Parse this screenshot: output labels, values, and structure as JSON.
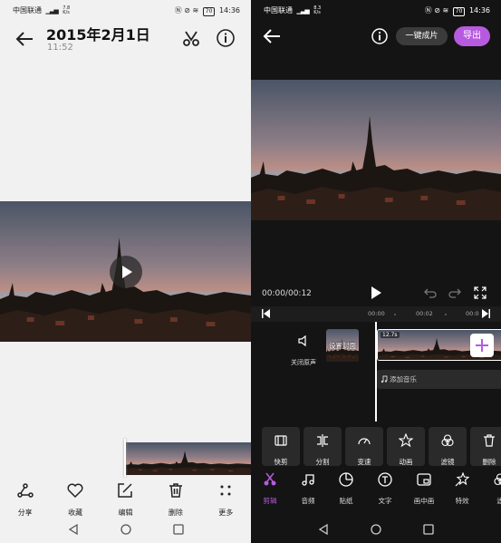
{
  "left": {
    "status": {
      "carrier": "中国联通",
      "network": "4G",
      "speed_value": "7.8",
      "speed_unit": "K/s",
      "battery": "70",
      "time": "14:36"
    },
    "title": "2015年2月1日",
    "time": "11:52",
    "toolbar": [
      {
        "label": "分享",
        "icon": "share-icon"
      },
      {
        "label": "收藏",
        "icon": "heart-icon"
      },
      {
        "label": "编辑",
        "icon": "edit-icon"
      },
      {
        "label": "删除",
        "icon": "trash-icon"
      },
      {
        "label": "更多",
        "icon": "more-icon"
      }
    ]
  },
  "right": {
    "status": {
      "carrier": "中国联通",
      "network": "4G",
      "speed_value": "8.3",
      "speed_unit": "K/s",
      "battery": "70",
      "time": "14:36"
    },
    "one_key_label": "一键成片",
    "export_label": "导出",
    "timecode": "00:00/00:12",
    "ticks": [
      "00:00",
      "00:02",
      "00:0"
    ],
    "mute_label": "关闭原声",
    "cover_label": "设置封面",
    "clip_duration": "12.7s",
    "add_music_label": "添加音乐",
    "tools": [
      {
        "label": "快剪",
        "icon": "trim-icon"
      },
      {
        "label": "分割",
        "icon": "split-icon"
      },
      {
        "label": "变速",
        "icon": "speed-icon"
      },
      {
        "label": "动画",
        "icon": "animation-icon"
      },
      {
        "label": "滤镜",
        "icon": "filter-icon"
      },
      {
        "label": "删除",
        "icon": "trash-icon"
      }
    ],
    "tabs": [
      {
        "label": "剪辑",
        "icon": "scissors-icon",
        "active": true
      },
      {
        "label": "音频",
        "icon": "music-icon"
      },
      {
        "label": "贴纸",
        "icon": "sticker-icon"
      },
      {
        "label": "文字",
        "icon": "text-icon"
      },
      {
        "label": "画中画",
        "icon": "pip-icon"
      },
      {
        "label": "特效",
        "icon": "effects-icon"
      },
      {
        "label": "滤",
        "icon": "filter-icon"
      }
    ]
  },
  "colors": {
    "accent": "#b65bdf",
    "dark_bg": "#141414",
    "light_bg": "#f1f1f1"
  }
}
